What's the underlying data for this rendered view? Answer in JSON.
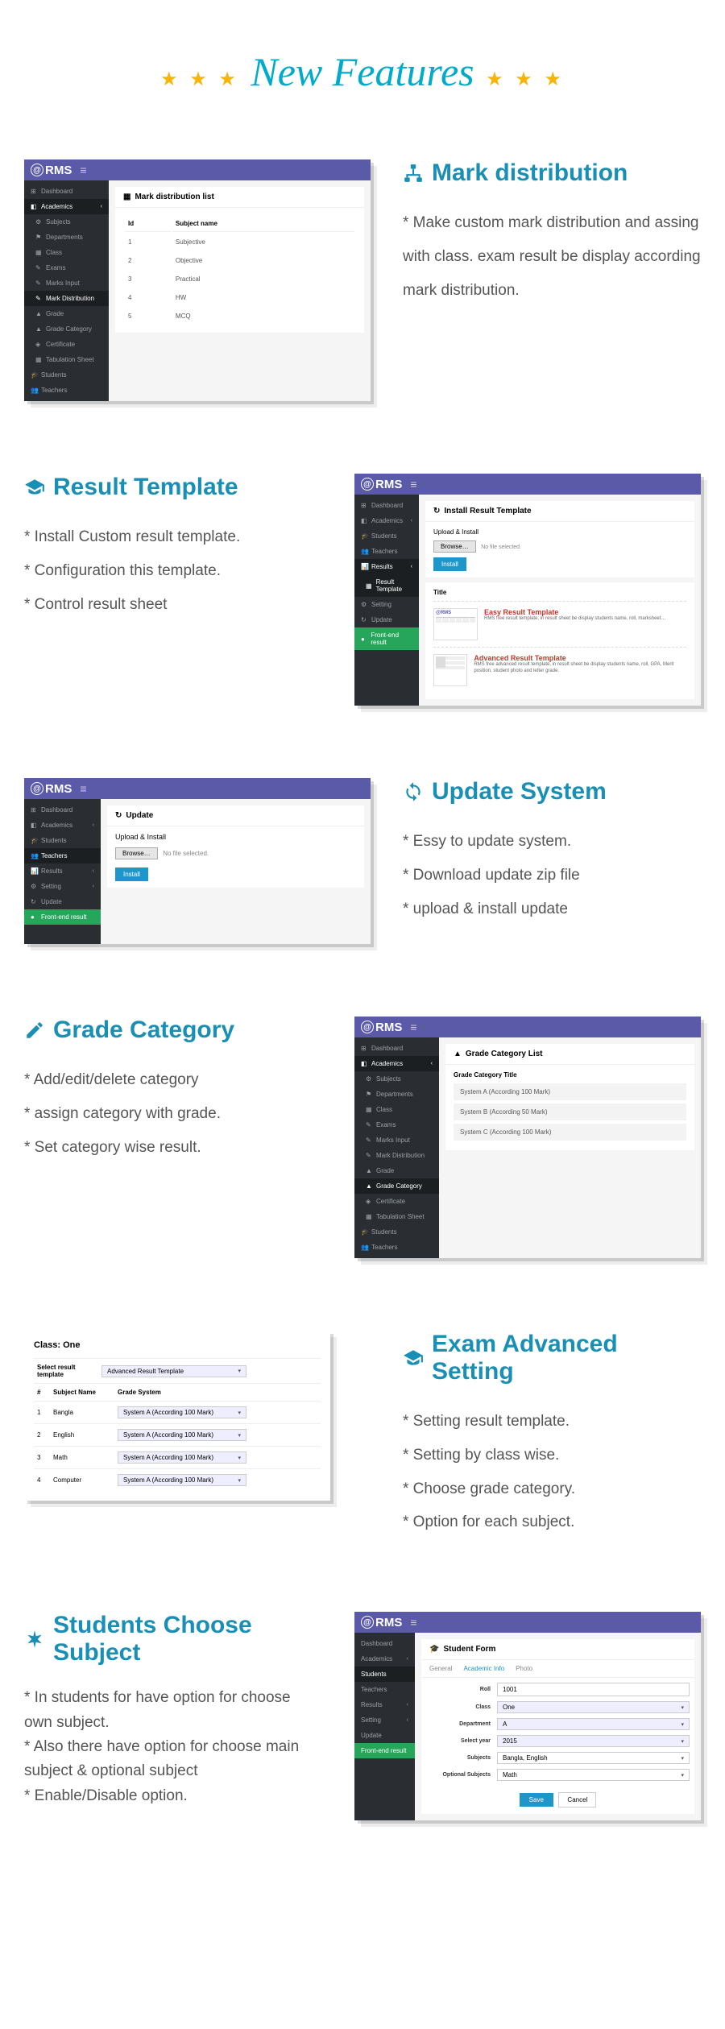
{
  "title": "New Features",
  "logo": "RMS",
  "features": {
    "mark_dist": {
      "title": "Mark distribution",
      "desc": "* Make custom mark distribution and assing with class. exam result be display according mark distribution.",
      "panel_title": "Mark distribution list",
      "col_id": "Id",
      "col_name": "Subject name",
      "rows": [
        {
          "id": "1",
          "name": "Subjective"
        },
        {
          "id": "2",
          "name": "Objective"
        },
        {
          "id": "3",
          "name": "Practical"
        },
        {
          "id": "4",
          "name": "HW"
        },
        {
          "id": "5",
          "name": "MCQ"
        }
      ],
      "sidebar": [
        "Dashboard",
        "Academics",
        "Subjects",
        "Departments",
        "Class",
        "Exams",
        "Marks Input",
        "Mark Distribution",
        "Grade",
        "Grade Category",
        "Certificate",
        "Tabulation Sheet",
        "Students",
        "Teachers"
      ]
    },
    "result_template": {
      "title": "Result Template",
      "b1": "* Install Custom result template.",
      "b2": "* Configuration this template.",
      "b3": "* Control result sheet",
      "panel_title": "Install Result Template",
      "upload_label": "Upload & Install",
      "browse": "Browse…",
      "nofile": "No file selected.",
      "install": "Install",
      "title_label": "Title",
      "t1_title": "Easy Result Template",
      "t1_desc": "RMS free result template, in result sheet be display students name, roll, marksheet…",
      "t2_title": "Advanced Result Template",
      "t2_desc": "RMS free advanced result template, in result sheet be display students name, roll, GPA, Merit position, student photo and letter grade.",
      "sidebar": [
        "Dashboard",
        "Academics",
        "Students",
        "Teachers",
        "Results",
        "Result Template",
        "Setting",
        "Update",
        "Front-end result"
      ]
    },
    "update": {
      "title": "Update System",
      "b1": "* Essy to update system.",
      "b2": "* Download update zip file",
      "b3": "* upload & install update",
      "panel_title": "Update",
      "upload_label": "Upload & Install",
      "browse": "Browse…",
      "nofile": "No file selected.",
      "install": "Install",
      "sidebar": [
        "Dashboard",
        "Academics",
        "Students",
        "Teachers",
        "Results",
        "Setting",
        "Update",
        "Front-end result"
      ]
    },
    "grade_category": {
      "title": "Grade Category",
      "b1": "* Add/edit/delete category",
      "b2": "* assign category with grade.",
      "b3": "* Set category wise result.",
      "panel_title": "Grade Category List",
      "col_title": "Grade Category Title",
      "rows": [
        "System A (According 100 Mark)",
        "System B (According 50 Mark)",
        "System C (According 100 Mark)"
      ],
      "sidebar": [
        "Dashboard",
        "Academics",
        "Subjects",
        "Departments",
        "Class",
        "Exams",
        "Marks Input",
        "Mark Distribution",
        "Grade",
        "Grade Category",
        "Certificate",
        "Tabulation Sheet",
        "Students",
        "Teachers"
      ]
    },
    "exam_advanced": {
      "title": "Exam Advanced Setting",
      "b1": "* Setting result template.",
      "b2": "* Setting by class wise.",
      "b3": "* Choose grade category.",
      "b4": "* Option for each subject.",
      "class_label": "Class: One",
      "select_template_label": "Select result template",
      "selected_template": "Advanced Result Template",
      "col_num": "#",
      "col_subject": "Subject Name",
      "col_grade": "Grade System",
      "rows": [
        {
          "n": "1",
          "s": "Bangla",
          "g": "System A (According 100 Mark)"
        },
        {
          "n": "2",
          "s": "English",
          "g": "System A (According 100 Mark)"
        },
        {
          "n": "3",
          "s": "Math",
          "g": "System A (According 100 Mark)"
        },
        {
          "n": "4",
          "s": "Computer",
          "g": "System A (According 100 Mark)"
        }
      ]
    },
    "students_subject": {
      "title": "Students Choose Subject",
      "b1": "* In students for have option for choose own subject.",
      "b2": "* Also there have option for choose main subject & optional subject",
      "b3": "* Enable/Disable option.",
      "panel_title": "Student Form",
      "tabs": {
        "general": "General",
        "academic": "Academic Info",
        "photo": "Photo"
      },
      "fields": {
        "roll_l": "Roll",
        "roll_v": "1001",
        "class_l": "Class",
        "class_v": "One",
        "dept_l": "Department",
        "dept_v": "A",
        "year_l": "Select year",
        "year_v": "2015",
        "subj_l": "Subjects",
        "subj_v": "Bangla, English",
        "opt_l": "Optional Subjects",
        "opt_v": "Math"
      },
      "save": "Save",
      "cancel": "Cancel",
      "sidebar": [
        "Dashboard",
        "Academics",
        "Students",
        "Teachers",
        "Results",
        "Setting",
        "Update",
        "Front-end result"
      ]
    }
  }
}
